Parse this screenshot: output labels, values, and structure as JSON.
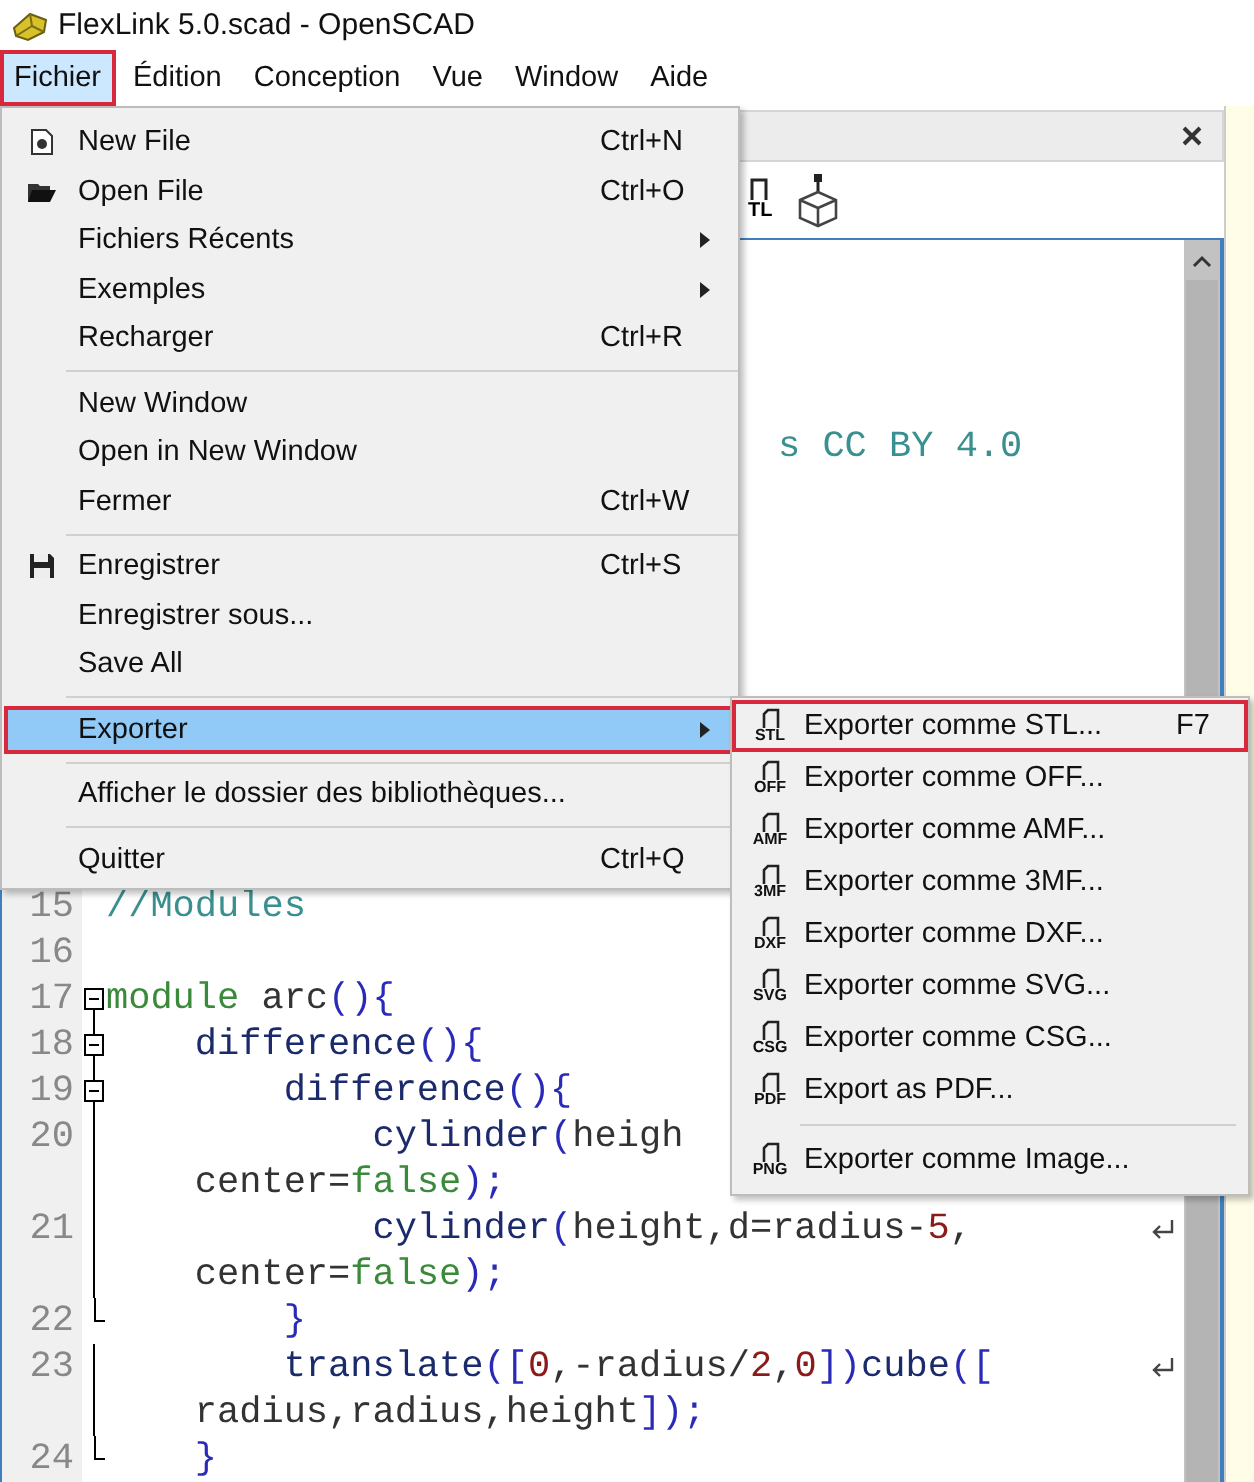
{
  "window": {
    "title": "FlexLink 5.0.scad - OpenSCAD"
  },
  "menubar": [
    {
      "label": "Fichier",
      "selected": true,
      "outlined": true
    },
    {
      "label": "Édition",
      "selected": false,
      "outlined": false
    },
    {
      "label": "Conception",
      "selected": false,
      "outlined": false
    },
    {
      "label": "Vue",
      "selected": false,
      "outlined": false
    },
    {
      "label": "Window",
      "selected": false,
      "outlined": false
    },
    {
      "label": "Aide",
      "selected": false,
      "outlined": false
    }
  ],
  "file_menu": [
    {
      "kind": "item",
      "label": "New File",
      "shortcut": "Ctrl+N",
      "submenu": false,
      "selected": false,
      "outlined": false
    },
    {
      "kind": "item",
      "label": "Open File",
      "shortcut": "Ctrl+O",
      "submenu": false,
      "selected": false,
      "outlined": false
    },
    {
      "kind": "item",
      "label": "Fichiers Récents",
      "submenu": true,
      "selected": false,
      "outlined": false
    },
    {
      "kind": "item",
      "label": "Exemples",
      "submenu": true,
      "selected": false,
      "outlined": false
    },
    {
      "kind": "item",
      "label": "Recharger",
      "shortcut": "Ctrl+R",
      "submenu": false,
      "selected": false,
      "outlined": false
    },
    {
      "kind": "separator"
    },
    {
      "kind": "item",
      "label": "New Window",
      "submenu": false,
      "selected": false,
      "outlined": false
    },
    {
      "kind": "item",
      "label": "Open in New Window",
      "submenu": false,
      "selected": false,
      "outlined": false
    },
    {
      "kind": "item",
      "label": "Fermer",
      "shortcut": "Ctrl+W",
      "submenu": false,
      "selected": false,
      "outlined": false
    },
    {
      "kind": "separator"
    },
    {
      "kind": "item",
      "label": "Enregistrer",
      "shortcut": "Ctrl+S",
      "submenu": false,
      "selected": false,
      "outlined": false
    },
    {
      "kind": "item",
      "label": "Enregistrer sous...",
      "submenu": false,
      "selected": false,
      "outlined": false
    },
    {
      "kind": "item",
      "label": "Save All",
      "submenu": false,
      "selected": false,
      "outlined": false
    },
    {
      "kind": "separator"
    },
    {
      "kind": "item",
      "label": "Exporter",
      "submenu": true,
      "selected": true,
      "outlined": true
    },
    {
      "kind": "separator"
    },
    {
      "kind": "item",
      "label": "Afficher le dossier des bibliothèques...",
      "submenu": false,
      "selected": false,
      "outlined": false
    },
    {
      "kind": "separator"
    },
    {
      "kind": "item",
      "label": "Quitter",
      "shortcut": "Ctrl+Q",
      "submenu": false,
      "selected": false,
      "outlined": false
    }
  ],
  "export_menu": [
    {
      "kind": "item",
      "format": "STL",
      "label": "Exporter comme STL...",
      "shortcut": "F7",
      "outlined": true
    },
    {
      "kind": "item",
      "format": "OFF",
      "label": "Exporter comme OFF...",
      "outlined": false
    },
    {
      "kind": "item",
      "format": "AMF",
      "label": "Exporter comme AMF...",
      "outlined": false
    },
    {
      "kind": "item",
      "format": "3MF",
      "label": "Exporter comme 3MF...",
      "outlined": false
    },
    {
      "kind": "item",
      "format": "DXF",
      "label": "Exporter comme DXF...",
      "outlined": false
    },
    {
      "kind": "item",
      "format": "SVG",
      "label": "Exporter comme SVG...",
      "outlined": false
    },
    {
      "kind": "item",
      "format": "CSG",
      "label": "Exporter comme CSG...",
      "outlined": false
    },
    {
      "kind": "item",
      "format": "PDF",
      "label": "Export as PDF...",
      "outlined": false
    },
    {
      "kind": "separator"
    },
    {
      "kind": "item",
      "format": "PNG",
      "label": "Exporter comme Image...",
      "outlined": false
    }
  ],
  "editor": {
    "toolbar_label": "TL",
    "rows": [
      {
        "kind": "fragment",
        "tokens": [
          {
            "kind": "comment",
            "text": "s CC BY 4.0"
          }
        ]
      },
      {
        "kind": "line",
        "number": "15",
        "tokens": [
          {
            "kind": "comment",
            "text": "//Modules"
          }
        ]
      },
      {
        "kind": "line",
        "number": "16",
        "tokens": []
      },
      {
        "kind": "line",
        "number": "17",
        "fold_start": true,
        "in_fold": false,
        "tokens": [
          {
            "kind": "keyword",
            "text": "module"
          },
          {
            "kind": "plain",
            "text": " arc"
          },
          {
            "kind": "punct",
            "text": "(){"
          }
        ]
      },
      {
        "kind": "line",
        "number": "18",
        "fold_start": true,
        "in_fold": true,
        "tokens": [
          {
            "kind": "function",
            "text": "    difference"
          },
          {
            "kind": "punct",
            "text": "(){"
          }
        ]
      },
      {
        "kind": "line",
        "number": "19",
        "fold_start": true,
        "in_fold": true,
        "tokens": [
          {
            "kind": "function",
            "text": "        difference"
          },
          {
            "kind": "punct",
            "text": "(){"
          }
        ]
      },
      {
        "kind": "line",
        "number": "20",
        "in_fold": true,
        "tokens": [
          {
            "kind": "function",
            "text": "            cylinder"
          },
          {
            "kind": "punct",
            "text": "("
          },
          {
            "kind": "plain",
            "text": "heigh"
          }
        ]
      },
      {
        "kind": "line",
        "in_fold": true,
        "tokens": [
          {
            "kind": "plain",
            "text": "    center="
          },
          {
            "kind": "bool",
            "text": "false"
          },
          {
            "kind": "punct",
            "text": ");"
          }
        ]
      },
      {
        "kind": "line",
        "number": "21",
        "in_fold": true,
        "wrapped": true,
        "tokens": [
          {
            "kind": "function",
            "text": "            cylinder"
          },
          {
            "kind": "punct",
            "text": "("
          },
          {
            "kind": "plain",
            "text": "height,d=radius-"
          },
          {
            "kind": "number",
            "text": "5"
          },
          {
            "kind": "plain",
            "text": ","
          }
        ]
      },
      {
        "kind": "line",
        "in_fold": true,
        "tokens": [
          {
            "kind": "plain",
            "text": "    center="
          },
          {
            "kind": "bool",
            "text": "false"
          },
          {
            "kind": "punct",
            "text": ");"
          }
        ]
      },
      {
        "kind": "line",
        "number": "22",
        "fold_end": true,
        "in_fold": true,
        "tokens": [
          {
            "kind": "punct",
            "text": "        }"
          }
        ]
      },
      {
        "kind": "line",
        "number": "23",
        "in_fold": true,
        "wrapped": true,
        "tokens": [
          {
            "kind": "function",
            "text": "        translate"
          },
          {
            "kind": "punct",
            "text": "(["
          },
          {
            "kind": "number",
            "text": "0"
          },
          {
            "kind": "plain",
            "text": ",-radius/"
          },
          {
            "kind": "number",
            "text": "2"
          },
          {
            "kind": "plain",
            "text": ","
          },
          {
            "kind": "number",
            "text": "0"
          },
          {
            "kind": "punct",
            "text": "])"
          },
          {
            "kind": "function",
            "text": "cube"
          },
          {
            "kind": "punct",
            "text": "(["
          }
        ]
      },
      {
        "kind": "line",
        "in_fold": true,
        "tokens": [
          {
            "kind": "plain",
            "text": "    radius,radius,height"
          },
          {
            "kind": "punct",
            "text": "]);"
          }
        ]
      },
      {
        "kind": "line",
        "number": "24",
        "fold_end": true,
        "in_fold": true,
        "tokens": [
          {
            "kind": "punct",
            "text": "    }"
          }
        ]
      }
    ]
  }
}
